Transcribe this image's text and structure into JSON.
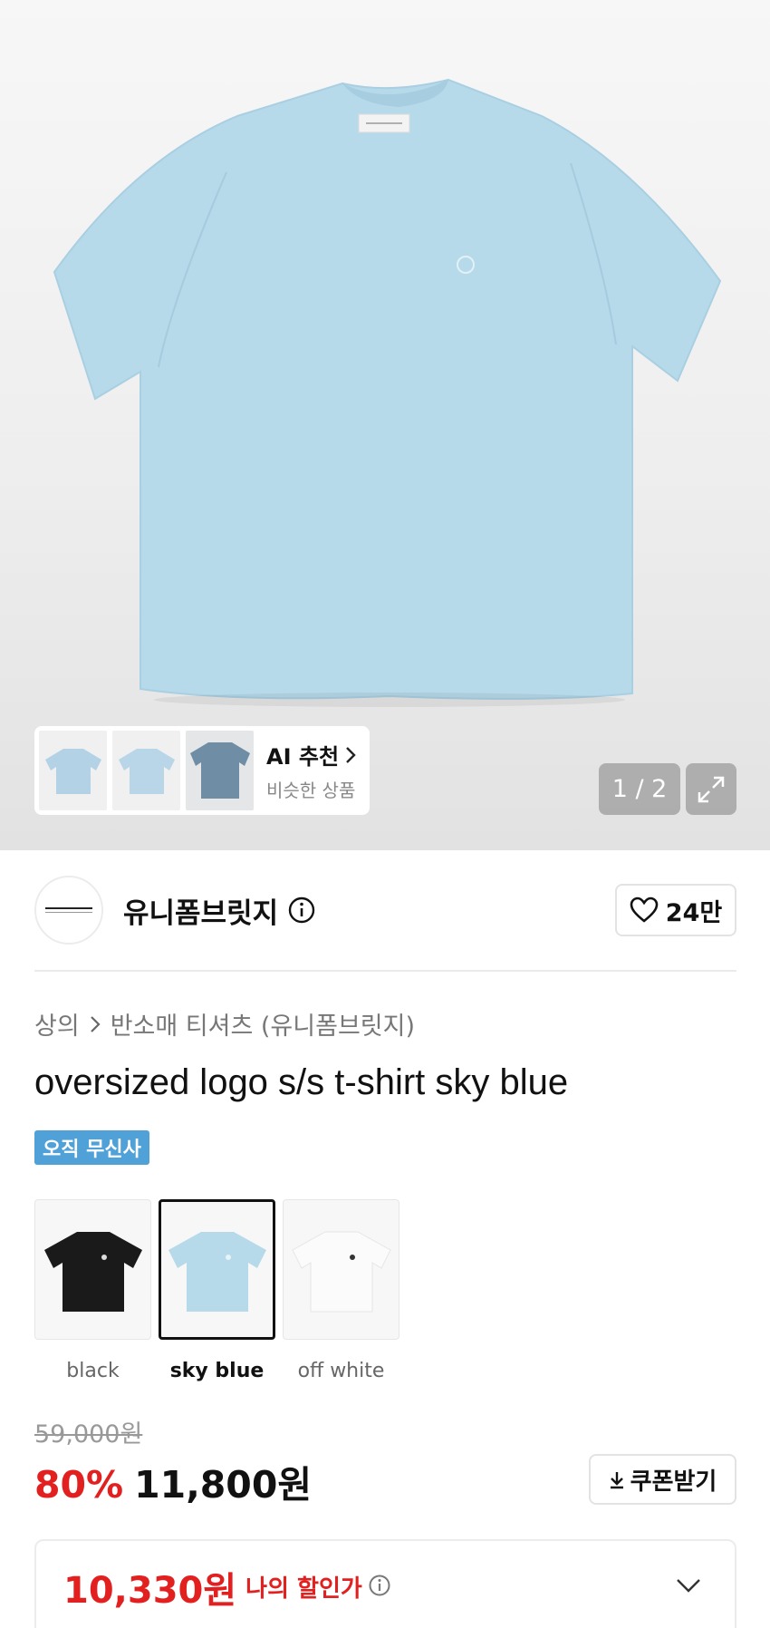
{
  "gallery": {
    "counter": "1 / 2",
    "ai_title": "AI 추천",
    "ai_subtitle": "비슷한 상품",
    "shirt_color": "#b7daea"
  },
  "brand": {
    "name": "유니폼브릿지",
    "likes": "24만"
  },
  "breadcrumb": {
    "category": "상의",
    "subcategory": "반소매 티셔츠 (유니폼브릿지)"
  },
  "product": {
    "title": "oversized logo s/s t-shirt sky blue",
    "badge": "오직 무신사",
    "colors": [
      {
        "label": "black",
        "color": "#1a1a1a"
      },
      {
        "label": "sky blue",
        "color": "#b7daea"
      },
      {
        "label": "off white",
        "color": "#f4f4f4"
      }
    ]
  },
  "pricing": {
    "original": "59,000원",
    "discount": "80%",
    "price": "11,800원",
    "coupon_label": "쿠폰받기",
    "my_price": "10,330원",
    "my_price_label": "나의 할인가"
  },
  "colors": {
    "accent_red": "#e22020",
    "badge_blue": "#4fa1d8"
  }
}
